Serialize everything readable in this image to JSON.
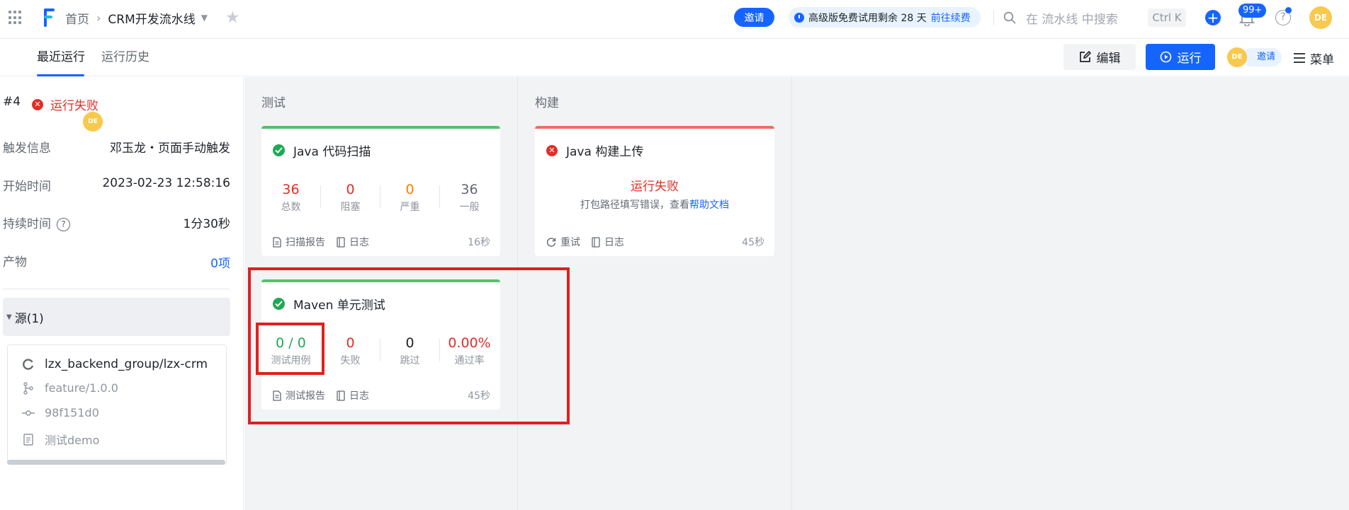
{
  "breadcrumb": {
    "home": "首页",
    "current": "CRM开发流水线"
  },
  "header": {
    "invite_label": "邀请",
    "trial_text": "高级版免费试用剩余 28 天",
    "trial_link": "前往续费",
    "search_placeholder": "在 流水线 中搜索",
    "shortcut": "Ctrl K",
    "plus_label": "+",
    "notification_count": "99+",
    "help_label": "?",
    "avatar_initials": "DE"
  },
  "tabs": {
    "recent": "最近运行",
    "history": "运行历史"
  },
  "toolbar": {
    "edit_label": "编辑",
    "run_label": "运行",
    "avatar_initials": "DE",
    "invite_label": "邀请",
    "menu_label": "菜单"
  },
  "run": {
    "number": "#4",
    "status": "运行失败",
    "trigger_label": "触发信息",
    "trigger_avatar": "DE",
    "trigger_value": "邓玉龙・页面手动触发",
    "start_label": "开始时间",
    "start_value": "2023-02-23 12:58:16",
    "duration_label": "持续时间",
    "duration_value": "1分30秒",
    "artifact_label": "产物",
    "artifact_value": "0项"
  },
  "source": {
    "header": "源(1)",
    "repo": "lzx_backend_group/lzx-crm",
    "branch": "feature/1.0.0",
    "commit": "98f151d0",
    "message": "测试demo"
  },
  "stages": [
    {
      "name": "测试"
    },
    {
      "name": "构建"
    }
  ],
  "jobs": {
    "scan": {
      "title": "Java 代码扫描",
      "stats": [
        {
          "value": "36",
          "label": "总数",
          "color": "#e22e28"
        },
        {
          "value": "0",
          "label": "阻塞",
          "color": "#e22e28"
        },
        {
          "value": "0",
          "label": "严重",
          "color": "#ff7d00"
        },
        {
          "value": "36",
          "label": "一般",
          "color": "#646a73"
        }
      ],
      "report": "扫描报告",
      "log": "日志",
      "duration": "16秒",
      "status_color": "#52c26b"
    },
    "build": {
      "title": "Java 构建上传",
      "status": "运行失败",
      "error_text": "打包路径填写错误，查看",
      "help_link": "帮助文档",
      "retry": "重试",
      "log": "日志",
      "duration": "45秒",
      "status_color": "#f26c60"
    },
    "maven": {
      "title": "Maven 单元测试",
      "stats": [
        {
          "value": "0 / 0",
          "label": "测试用例",
          "color": "#1fa855"
        },
        {
          "value": "0",
          "label": "失败",
          "color": "#e22e28"
        },
        {
          "value": "0",
          "label": "跳过",
          "color": "#1f2329"
        },
        {
          "value": "0.00%",
          "label": "通过率",
          "color": "#e22e28"
        }
      ],
      "report": "测试报告",
      "log": "日志",
      "duration": "45秒",
      "status_color": "#52c26b"
    }
  }
}
